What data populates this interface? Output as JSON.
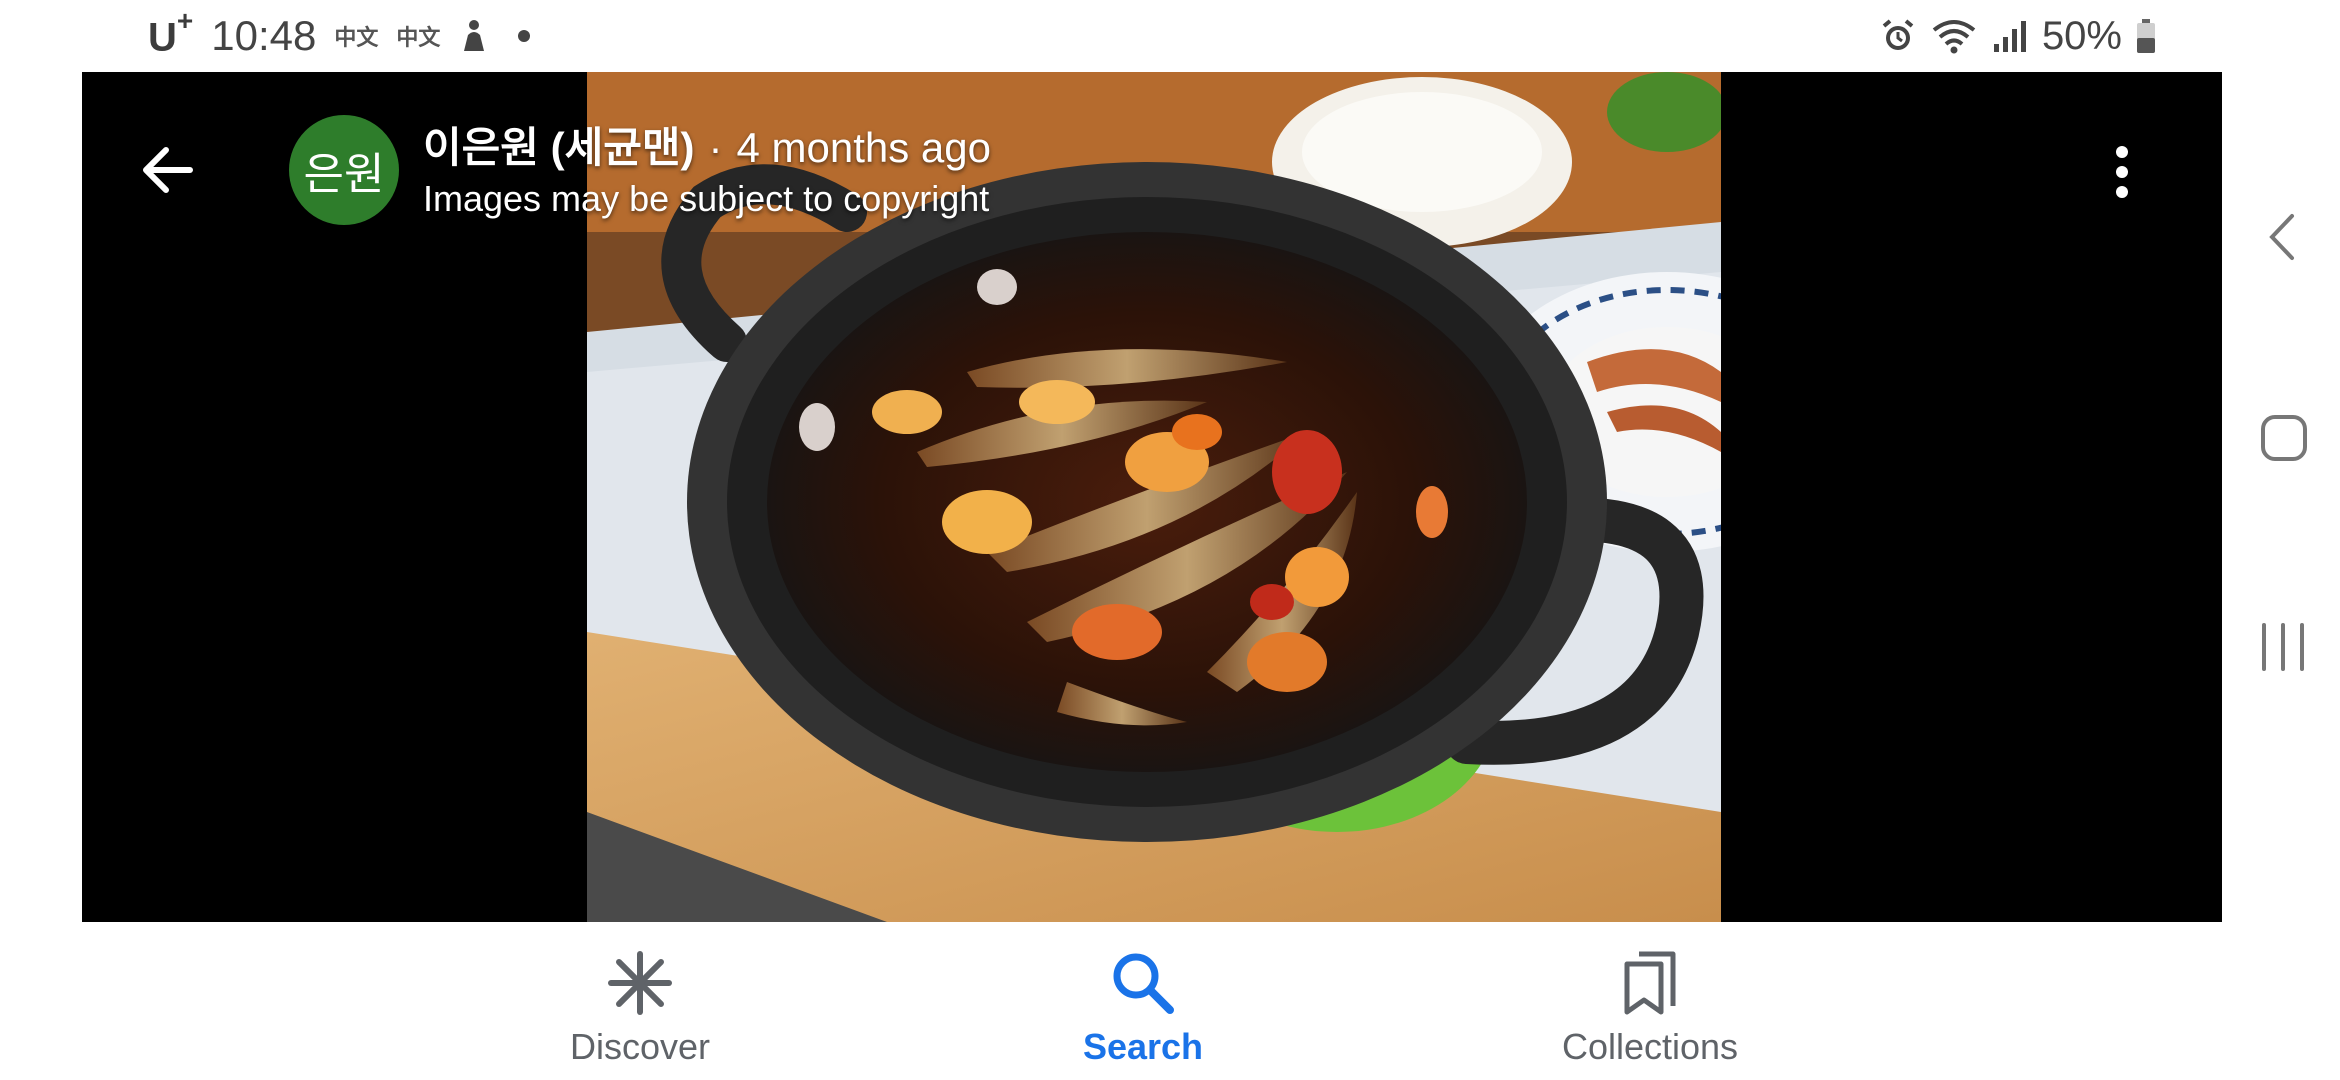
{
  "status_bar": {
    "carrier": "U",
    "carrier_sup": "+",
    "time": "10:48",
    "notif_1": "中文",
    "notif_2": "中文",
    "battery_percent": "50%"
  },
  "viewer": {
    "avatar_text": "은원",
    "author": "이은원 (세균맨)",
    "separator": "·",
    "posted": "4 months ago",
    "copyright_notice": "Images may be subject to copyright"
  },
  "bottom_nav": {
    "items": [
      {
        "label": "Discover",
        "icon": "asterisk-icon"
      },
      {
        "label": "Search",
        "icon": "search-icon",
        "active": true
      },
      {
        "label": "Collections",
        "icon": "collections-icon"
      }
    ]
  },
  "colors": {
    "active": "#1a73e8",
    "inactive": "#5f6368",
    "avatar": "#2e7d2b"
  }
}
